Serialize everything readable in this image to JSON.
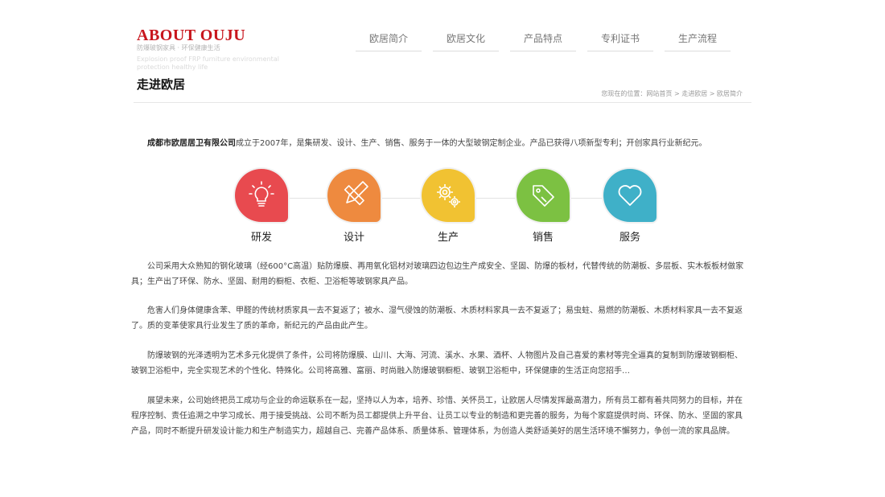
{
  "header": {
    "logo_title": "ABOUT OUJU",
    "logo_subtitle": "防爆玻钢家具 · 环保健康生活",
    "logo_english": "Explosion proof FRP furniture  environmental protection healthy life"
  },
  "nav": {
    "items": [
      "欧居简介",
      "欧居文化",
      "产品特点",
      "专利证书",
      "生产流程"
    ]
  },
  "section": {
    "title": "走进欧居",
    "breadcrumb": "您现在的位置：网站首页 > 走进欧居 > 欧居简介"
  },
  "intro": {
    "company": "成都市欧居居卫有限公司",
    "text": "成立于2007年，是集研发、设计、生产、销售、服务于一体的大型玻钢定制企业。产品已获得八项新型专利；开创家具行业新纪元。"
  },
  "process": [
    {
      "label": "研发",
      "icon": "lightbulb-icon",
      "color": "#e84a4f"
    },
    {
      "label": "设计",
      "icon": "pencil-ruler-icon",
      "color": "#ee8a3f"
    },
    {
      "label": "生产",
      "icon": "gears-icon",
      "color": "#f1c232"
    },
    {
      "label": "销售",
      "icon": "price-tag-icon",
      "color": "#7cc142"
    },
    {
      "label": "服务",
      "icon": "heart-icon",
      "color": "#3fb0c8"
    }
  ],
  "paragraphs": [
    "公司采用大众熟知的钢化玻璃（经600°C高温）贴防爆膜、再用氧化铝材对玻璃四边包边生产成安全、坚固、防爆的板材，代替传统的防潮板、多层板、实木板板材做家具；生产出了环保、防水、坚固、耐用的橱柜、衣柜、卫浴柜等玻钢家具产品。",
    "危害人们身体健康含苯、甲醛的传统材质家具一去不复返了；被水、湿气侵蚀的防潮板、木质材料家具一去不复返了；易虫蛀、易燃的防潮板、木质材料家具一去不复返了。质的变革使家具行业发生了质的革命，新纪元的产品由此产生。",
    "防爆玻钢的光泽透明为艺术多元化提供了条件，公司将防爆膜、山川、大海、河流、溪水、水果、酒杯、人物图片及自己喜爱的素材等完全逼真的复制到防爆玻钢橱柜、玻钢卫浴柜中，完全实现艺术的个性化、特殊化。公司将高雅、富丽、时尚融入防爆玻钢橱柜、玻钢卫浴柜中，环保健康的生活正向您招手…",
    "展望未来，公司始终把员工成功与企业的命运联系在一起，坚持以人为本，培养、珍惜、关怀员工，让欧居人尽情发挥最高潜力，所有员工都有着共同努力的目标，并在程序控制、责任追溯之中学习成长、用于接受挑战、公司不断为员工都提供上升平台、让员工以专业的制造和更完善的服务，为每个家庭提供时尚、环保、防水、坚固的家具产品，同时不断提升研发设计能力和生产制造实力，超越自己、完善产品体系、质量体系、管理体系，为创造人类舒适美好的居生活环境不懈努力，争创一流的家具品牌。"
  ]
}
